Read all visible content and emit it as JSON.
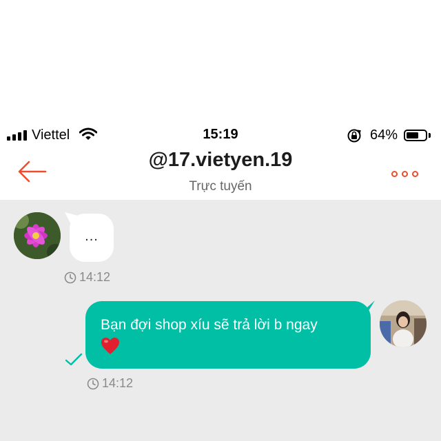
{
  "status_bar": {
    "carrier": "Viettel",
    "time": "15:19",
    "battery_percent_text": "64%",
    "battery_level": 0.64
  },
  "header": {
    "title": "@17.vietyen.19",
    "subtitle": "Trực tuyến",
    "back_icon": "arrow-left-icon",
    "more_icon": "more-dots-icon"
  },
  "messages": [
    {
      "direction": "incoming",
      "text": "...",
      "time": "14:12"
    },
    {
      "direction": "outgoing",
      "text": "Bạn đợi shop xíu sẽ trả lời b ngay",
      "emoji": "heart",
      "time": "14:12",
      "status_icon": "check-icon"
    }
  ],
  "colors": {
    "accent": "#ee4d2d",
    "outgoing_bubble": "#00bfa5",
    "chat_background": "#ebebeb",
    "incoming_bubble": "#ffffff",
    "timestamp": "#8a8a8a"
  }
}
